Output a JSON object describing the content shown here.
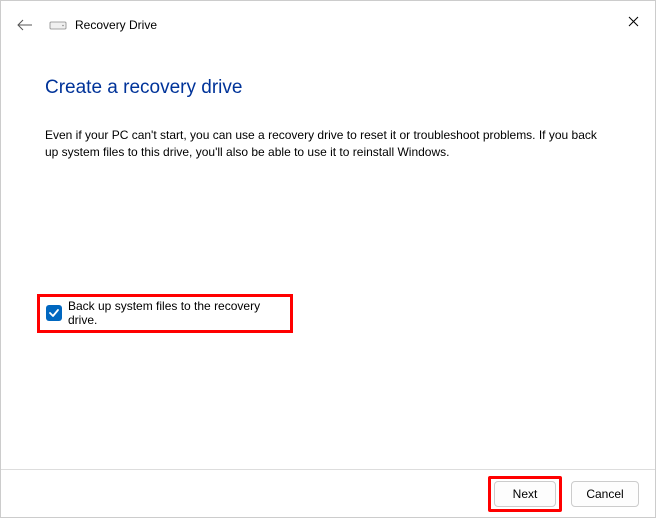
{
  "titlebar": {
    "title": "Recovery Drive"
  },
  "main": {
    "heading": "Create a recovery drive",
    "description": "Even if your PC can't start, you can use a recovery drive to reset it or troubleshoot problems. If you back up system files to this drive, you'll also be able to use it to reinstall Windows."
  },
  "checkbox": {
    "label": "Back up system files to the recovery drive.",
    "checked": true
  },
  "footer": {
    "next": "Next",
    "cancel": "Cancel"
  }
}
